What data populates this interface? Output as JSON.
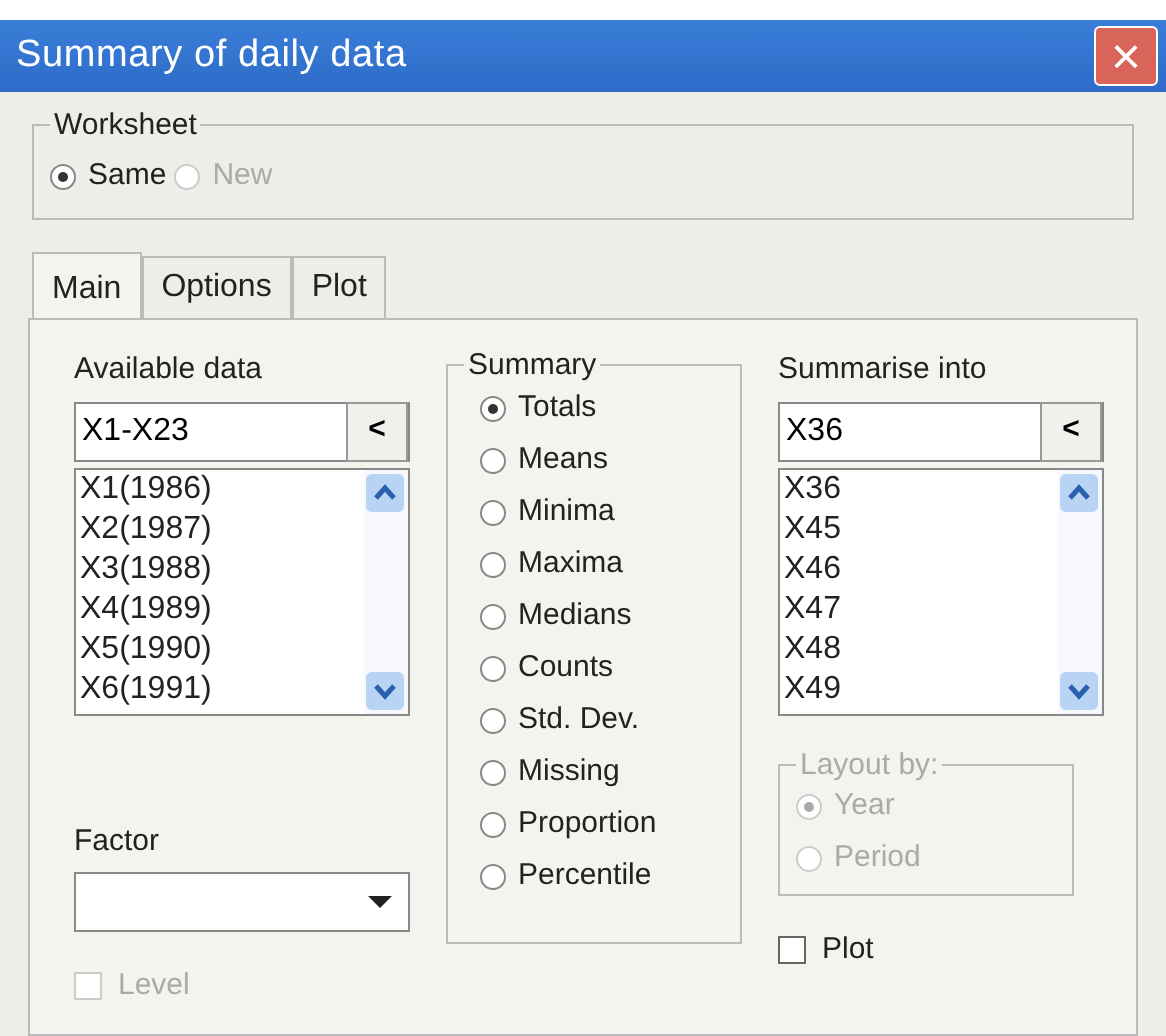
{
  "window": {
    "title": "Summary of daily data",
    "close": "×"
  },
  "worksheet": {
    "label": "Worksheet",
    "options": [
      {
        "label": "Same",
        "selected": true,
        "disabled": false
      },
      {
        "label": "New",
        "selected": false,
        "disabled": true
      }
    ]
  },
  "tabs": [
    {
      "label": "Main",
      "selected": true
    },
    {
      "label": "Options",
      "selected": false
    },
    {
      "label": "Plot",
      "selected": false
    }
  ],
  "available_data": {
    "label": "Available data",
    "value": "X1-X23",
    "button": "<",
    "items": [
      "X1(1986)",
      "X2(1987)",
      "X3(1988)",
      "X4(1989)",
      "X5(1990)",
      "X6(1991)"
    ]
  },
  "factor": {
    "label": "Factor"
  },
  "level": {
    "label": "Level",
    "checked": false,
    "disabled": true
  },
  "summary": {
    "label": "Summary",
    "options": [
      {
        "label": "Totals",
        "selected": true
      },
      {
        "label": "Means",
        "selected": false
      },
      {
        "label": "Minima",
        "selected": false
      },
      {
        "label": "Maxima",
        "selected": false
      },
      {
        "label": "Medians",
        "selected": false
      },
      {
        "label": "Counts",
        "selected": false
      },
      {
        "label": "Std. Dev.",
        "selected": false
      },
      {
        "label": "Missing",
        "selected": false
      },
      {
        "label": "Proportion",
        "selected": false
      },
      {
        "label": "Percentile",
        "selected": false
      }
    ]
  },
  "summarise_into": {
    "label": "Summarise into",
    "value": "X36",
    "button": "<",
    "items": [
      "X36",
      "X45",
      "X46",
      "X47",
      "X48",
      "X49"
    ]
  },
  "layout_by": {
    "label": "Layout by:",
    "disabled": true,
    "options": [
      {
        "label": "Year",
        "selected": true
      },
      {
        "label": "Period",
        "selected": false
      }
    ]
  },
  "plot": {
    "label": "Plot",
    "checked": false,
    "disabled": false
  }
}
